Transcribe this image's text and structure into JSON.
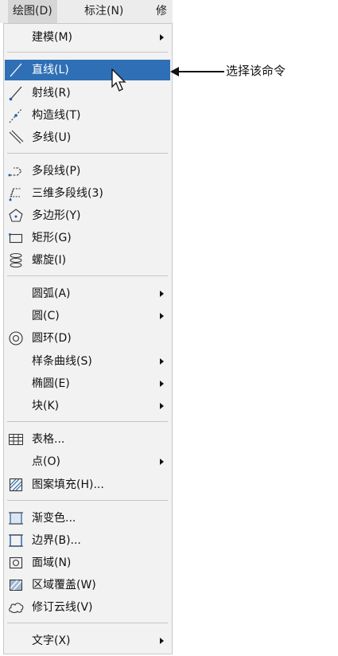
{
  "menubar": {
    "items": [
      "绘图(D)",
      "标注(N)",
      "修"
    ]
  },
  "menu": {
    "items": [
      {
        "label": "建模(M)",
        "icon": "none",
        "submenu": true
      },
      {
        "label": "直线(L)",
        "icon": "line-icon",
        "highlighted": true
      },
      {
        "label": "射线(R)",
        "icon": "ray-icon"
      },
      {
        "label": "构造线(T)",
        "icon": "construction-line-icon"
      },
      {
        "label": "多线(U)",
        "icon": "multiline-icon"
      },
      {
        "label": "多段线(P)",
        "icon": "polyline-icon"
      },
      {
        "label": "三维多段线(3)",
        "icon": "3d-polyline-icon"
      },
      {
        "label": "多边形(Y)",
        "icon": "polygon-icon"
      },
      {
        "label": "矩形(G)",
        "icon": "rectangle-icon"
      },
      {
        "label": "螺旋(I)",
        "icon": "helix-icon"
      },
      {
        "label": "圆弧(A)",
        "icon": "none",
        "submenu": true
      },
      {
        "label": "圆(C)",
        "icon": "none",
        "submenu": true
      },
      {
        "label": "圆环(D)",
        "icon": "donut-icon"
      },
      {
        "label": "样条曲线(S)",
        "icon": "none",
        "submenu": true
      },
      {
        "label": "椭圆(E)",
        "icon": "none",
        "submenu": true
      },
      {
        "label": "块(K)",
        "icon": "none",
        "submenu": true
      },
      {
        "label": "表格...",
        "icon": "table-icon"
      },
      {
        "label": "点(O)",
        "icon": "none",
        "submenu": true
      },
      {
        "label": "图案填充(H)...",
        "icon": "hatch-icon"
      },
      {
        "label": "渐变色...",
        "icon": "gradient-icon"
      },
      {
        "label": "边界(B)...",
        "icon": "boundary-icon"
      },
      {
        "label": "面域(N)",
        "icon": "region-icon"
      },
      {
        "label": "区域覆盖(W)",
        "icon": "wipeout-icon"
      },
      {
        "label": "修订云线(V)",
        "icon": "revcloud-icon"
      },
      {
        "label": "文字(X)",
        "icon": "none",
        "submenu": true
      }
    ]
  },
  "callout": {
    "text": "选择该命令"
  },
  "colors": {
    "highlight": "#2f6fb6",
    "icon_blue": "#1f5fa8"
  }
}
